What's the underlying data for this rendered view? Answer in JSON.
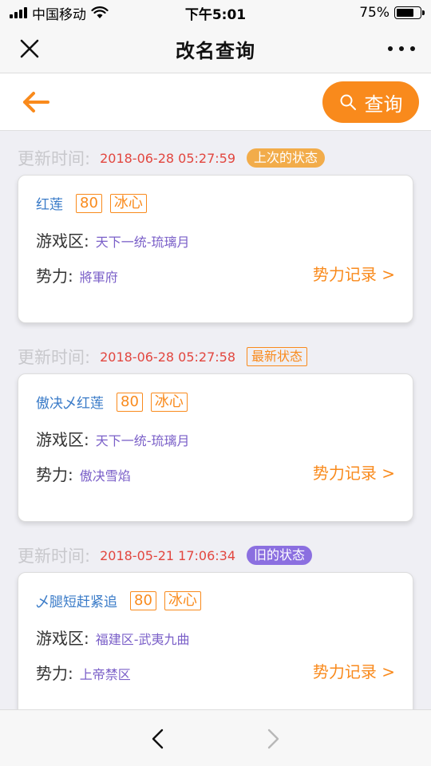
{
  "status_bar": {
    "carrier": "中国移动",
    "time": "下午5:01",
    "battery": "75%",
    "battery_level": 0.75
  },
  "nav": {
    "title": "改名查询"
  },
  "toolbar": {
    "query_label": "查询",
    "accent_color": "#f98a1c"
  },
  "records": [
    {
      "time_label": "更新时间:",
      "timestamp": "2018-06-28 05:27:59",
      "badge": "上次的状态",
      "name": "红莲",
      "level": "80",
      "school": "冰心",
      "zone_label": "游戏区:",
      "zone": "天下一统-琉璃月",
      "faction_label": "势力:",
      "faction": "將軍府",
      "link": "势力记录 >"
    },
    {
      "time_label": "更新时间:",
      "timestamp": "2018-06-28 05:27:58",
      "badge": "最新状态",
      "name": "傲决乄红莲",
      "level": "80",
      "school": "冰心",
      "zone_label": "游戏区:",
      "zone": "天下一统-琉璃月",
      "faction_label": "势力:",
      "faction": "傲决雪焰",
      "link": "势力记录 >"
    },
    {
      "time_label": "更新时间:",
      "timestamp": "2018-05-21 17:06:34",
      "badge": "旧的状态",
      "name": "乄腿短赶紧追",
      "level": "80",
      "school": "冰心",
      "zone_label": "游戏区:",
      "zone": "福建区-武夷九曲",
      "faction_label": "势力:",
      "faction": "上帝禁区",
      "link": "势力记录 >"
    }
  ],
  "icons": {
    "close": "close-icon",
    "more": "more-icon",
    "back": "arrow-left-icon",
    "search": "search-icon",
    "nav_back": "chevron-left-icon",
    "nav_forward": "chevron-right-icon"
  }
}
